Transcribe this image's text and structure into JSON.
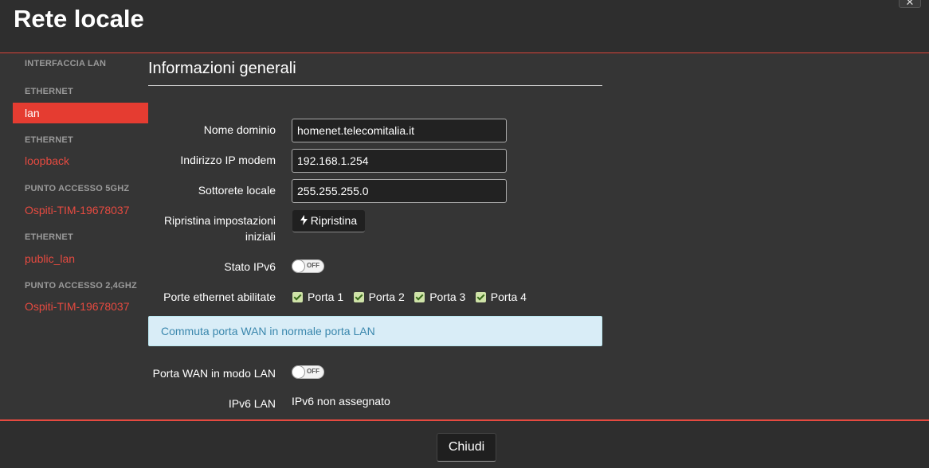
{
  "window": {
    "title": "Rete locale",
    "close_glyph": "✕"
  },
  "sidebar": {
    "items": [
      {
        "section": "INTERFACCIA LAN"
      },
      {
        "section": "ETHERNET",
        "label": "lan",
        "active": true
      },
      {
        "section": "ETHERNET",
        "label": "loopback"
      },
      {
        "section": "PUNTO ACCESSO 5GHZ",
        "label": "Ospiti-TIM-19678037"
      },
      {
        "section": "ETHERNET",
        "label": "public_lan"
      },
      {
        "section": "PUNTO ACCESSO 2,4GHZ",
        "label": "Ospiti-TIM-19678037"
      }
    ]
  },
  "main": {
    "section_title": "Informazioni generali",
    "domain": {
      "label": "Nome dominio",
      "value": "homenet.telecomitalia.it"
    },
    "modem_ip": {
      "label": "Indirizzo IP modem",
      "value": "192.168.1.254"
    },
    "subnet": {
      "label": "Sottorete locale",
      "value": "255.255.255.0"
    },
    "reset": {
      "label_line1": "Ripristina impostazioni",
      "label_line2": "iniziali",
      "button": "Ripristina",
      "icon": "bolt-icon"
    },
    "ipv6_state": {
      "label": "Stato IPv6",
      "toggle": "OFF"
    },
    "ports": {
      "label": "Porte ethernet abilitate",
      "items": [
        "Porta 1",
        "Porta 2",
        "Porta 3",
        "Porta 4"
      ]
    },
    "info_box": "Commuta porta WAN in normale porta LAN",
    "wan_lan": {
      "label": "Porta WAN in modo LAN",
      "toggle": "OFF"
    },
    "ipv6_lan": {
      "label": "IPv6 LAN",
      "value": "IPv6 non assegnato"
    }
  },
  "footer": {
    "close_button": "Chiudi"
  },
  "colors": {
    "accent": "#e64a40",
    "active_bg": "#e53c31",
    "info_bg": "#d9edf7",
    "info_text": "#3a87ad"
  }
}
